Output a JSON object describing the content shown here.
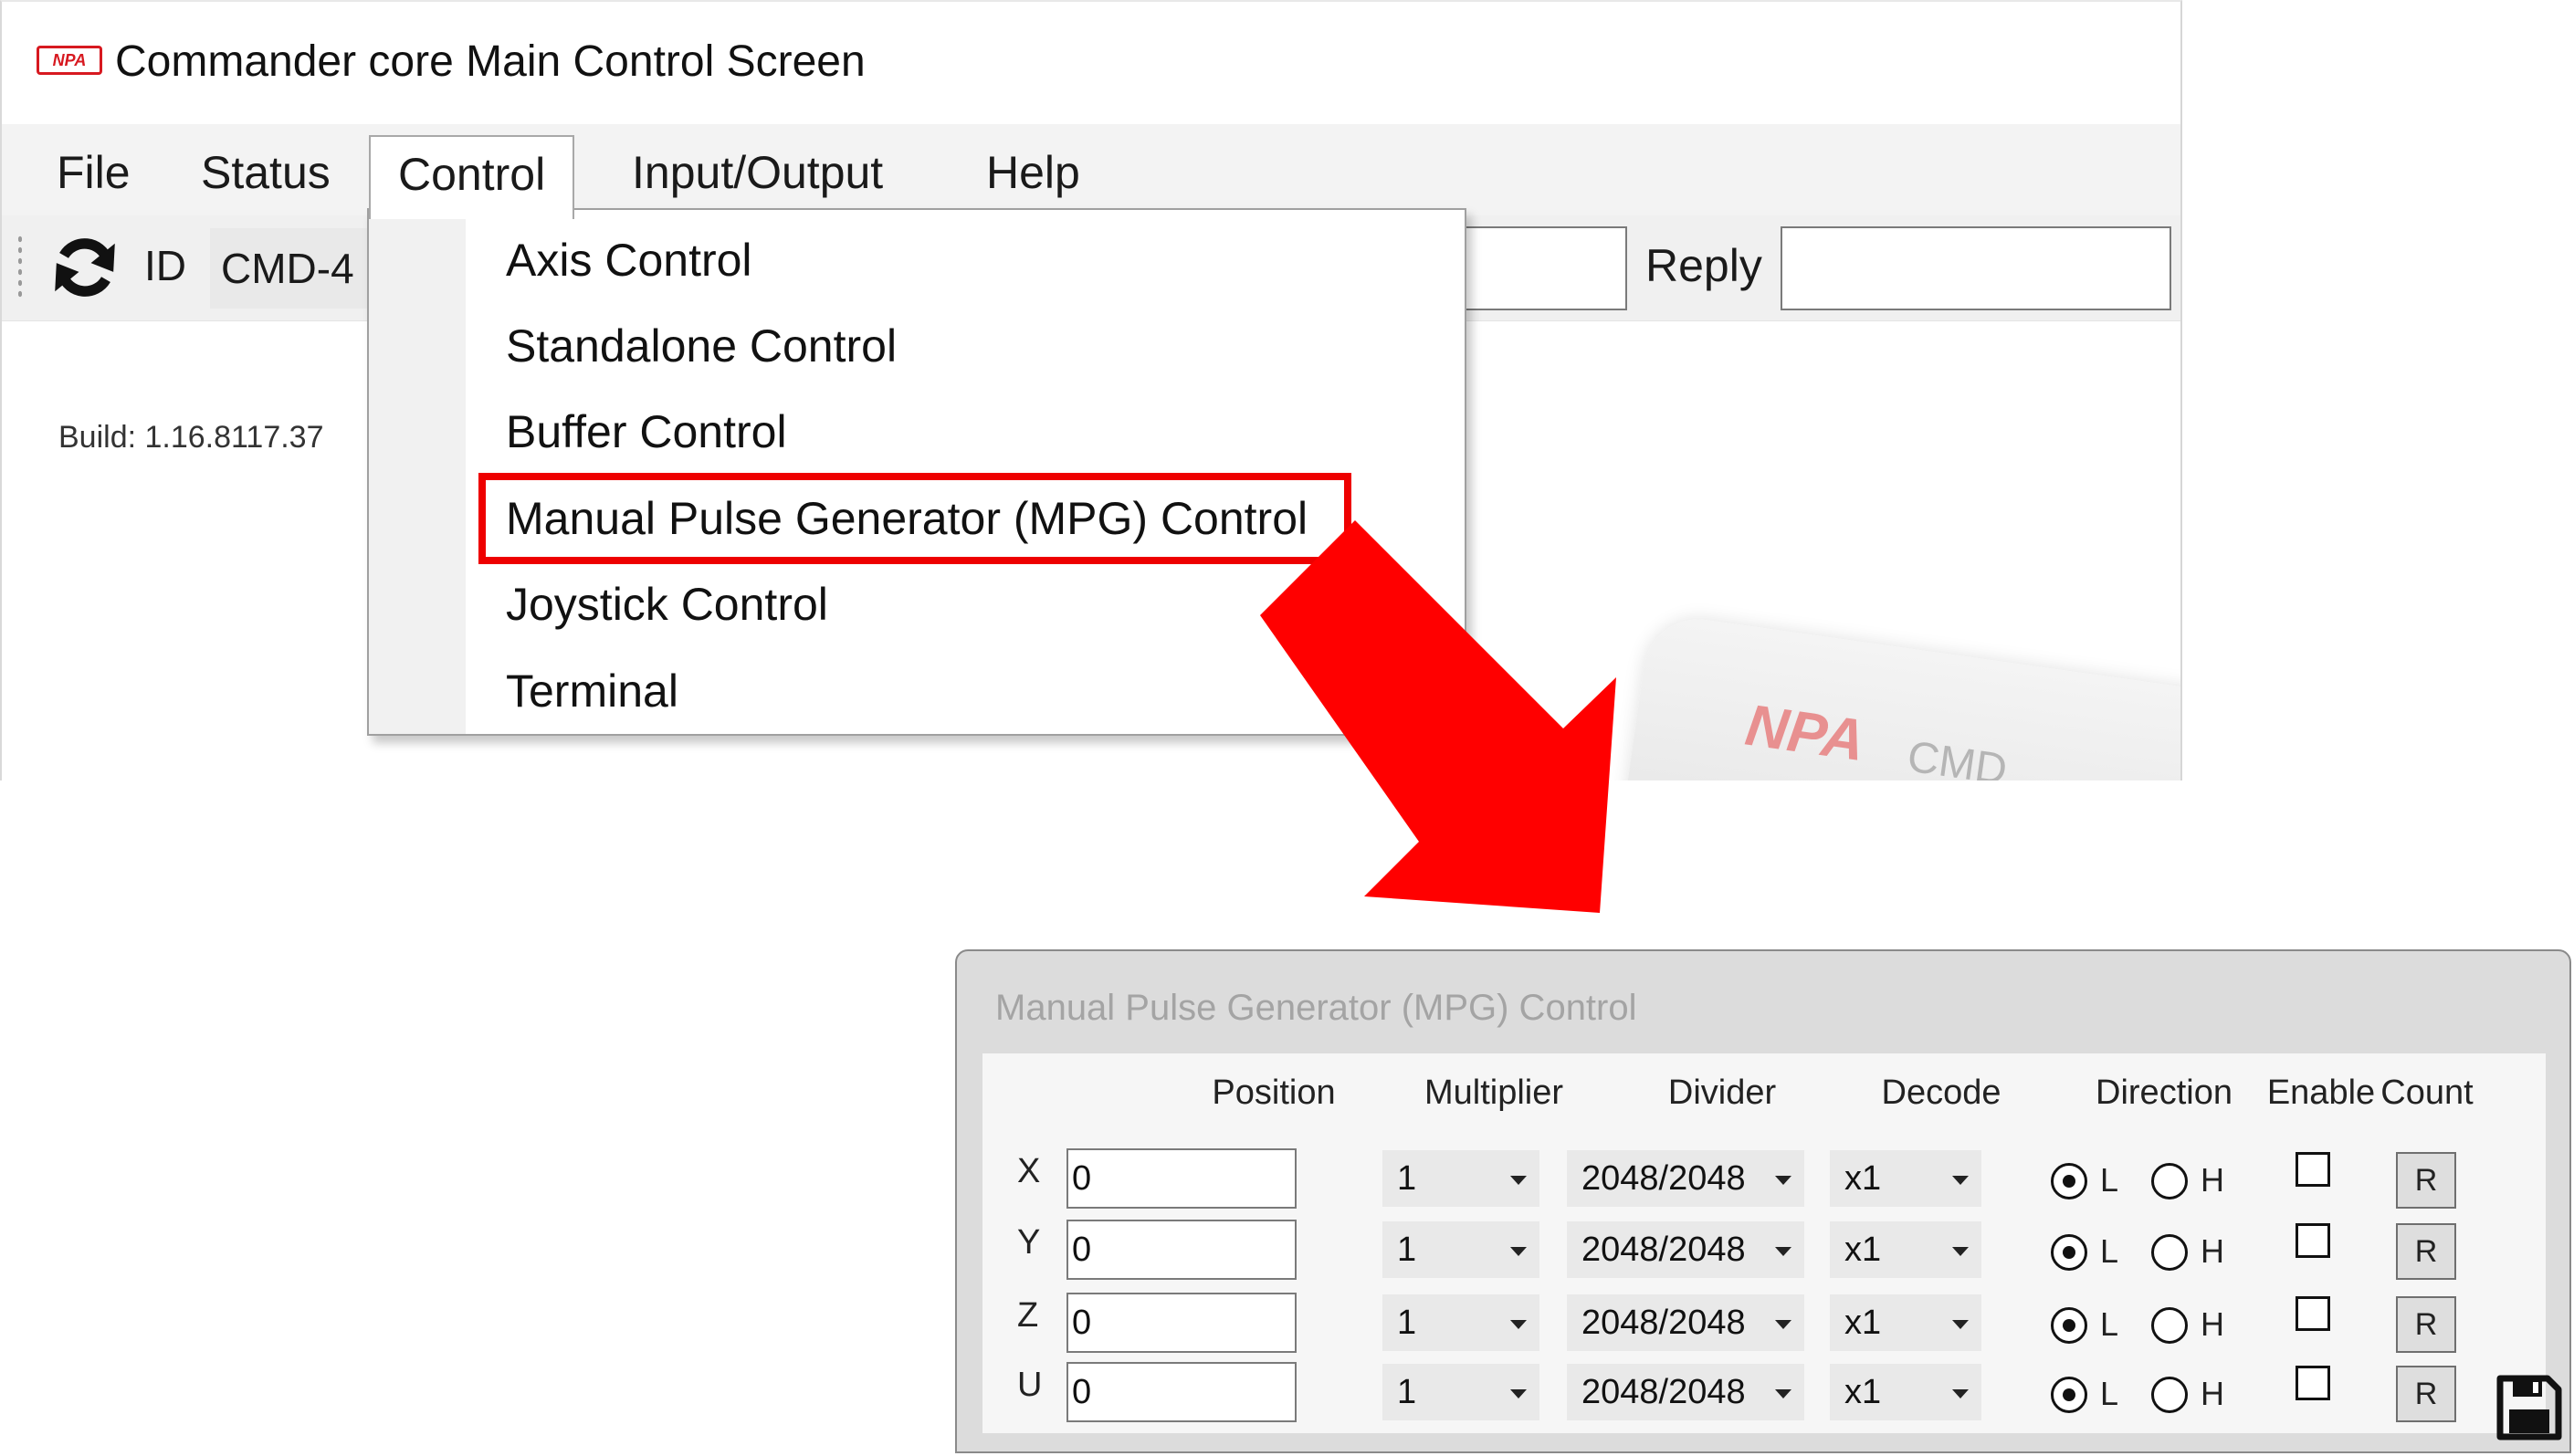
{
  "main_window": {
    "title": "Commander core Main Control Screen",
    "logo_text": "NPA",
    "menu": [
      "File",
      "Status",
      "Control",
      "Input/Output",
      "Help"
    ],
    "toolbar": {
      "id_label": "ID",
      "id_value": "CMD-4",
      "reply_label": "Reply",
      "reply_value": ""
    },
    "build_text": "Build: 1.16.8117.37",
    "product": {
      "brand": "NPA",
      "model": "CMD"
    }
  },
  "control_menu": {
    "items": [
      "Axis Control",
      "Standalone Control",
      "Buffer Control",
      "Manual Pulse Generator (MPG) Control",
      "Joystick Control",
      "Terminal"
    ],
    "highlighted": "Manual Pulse Generator (MPG) Control"
  },
  "colors": {
    "highlight": "#ee0000",
    "arrow": "#ff0000",
    "logo": "#d71920"
  },
  "mpg_window": {
    "title": "Manual Pulse Generator (MPG) Control",
    "headers": {
      "position": "Position",
      "multiplier": "Multiplier",
      "divider": "Divider",
      "decode": "Decode",
      "direction": "Direction",
      "enable": "Enable",
      "count": "Count"
    },
    "direction_options": [
      "L",
      "H"
    ],
    "reset_label": "R",
    "rows": [
      {
        "axis": "X",
        "position": "0",
        "multiplier": "1",
        "divider": "2048/2048",
        "decode": "x1",
        "direction": "L",
        "enabled": false
      },
      {
        "axis": "Y",
        "position": "0",
        "multiplier": "1",
        "divider": "2048/2048",
        "decode": "x1",
        "direction": "L",
        "enabled": false
      },
      {
        "axis": "Z",
        "position": "0",
        "multiplier": "1",
        "divider": "2048/2048",
        "decode": "x1",
        "direction": "L",
        "enabled": false
      },
      {
        "axis": "U",
        "position": "0",
        "multiplier": "1",
        "divider": "2048/2048",
        "decode": "x1",
        "direction": "L",
        "enabled": false
      }
    ]
  }
}
